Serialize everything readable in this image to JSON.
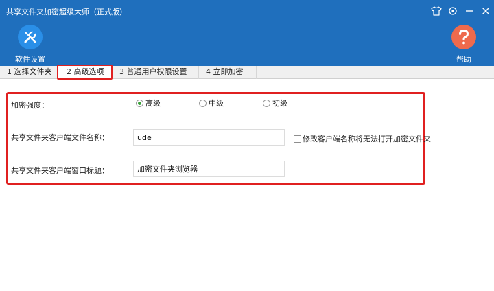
{
  "window": {
    "title": "共享文件夹加密超级大师（正式版）"
  },
  "toolbar": {
    "settings_label": "软件设置",
    "help_label": "帮助"
  },
  "tabs": [
    {
      "label": "1 选择文件夹"
    },
    {
      "label": "2 高级选项"
    },
    {
      "label": "3 普通用户权限设置"
    },
    {
      "label": "4 立即加密"
    }
  ],
  "form": {
    "strength_label": "加密强度：",
    "strength_options": [
      {
        "label": "高级",
        "selected": true
      },
      {
        "label": "中级",
        "selected": false
      },
      {
        "label": "初级",
        "selected": false
      }
    ],
    "client_filename_label": "共享文件夹客户端文件名称：",
    "client_filename_value": "ude",
    "rename_warning_label": "修改客户端名称将无法打开加密文件夹",
    "window_title_label": "共享文件夹客户端窗口标题：",
    "window_title_value": "加密文件夹浏览器"
  },
  "colors": {
    "header_bg": "#1f6fbd",
    "highlight_border": "#e02020",
    "radio_selected": "#39a13a"
  },
  "icons": [
    "wrench-icon",
    "question-icon",
    "tshirt-icon",
    "settings-icon",
    "minimize-icon",
    "close-icon"
  ]
}
